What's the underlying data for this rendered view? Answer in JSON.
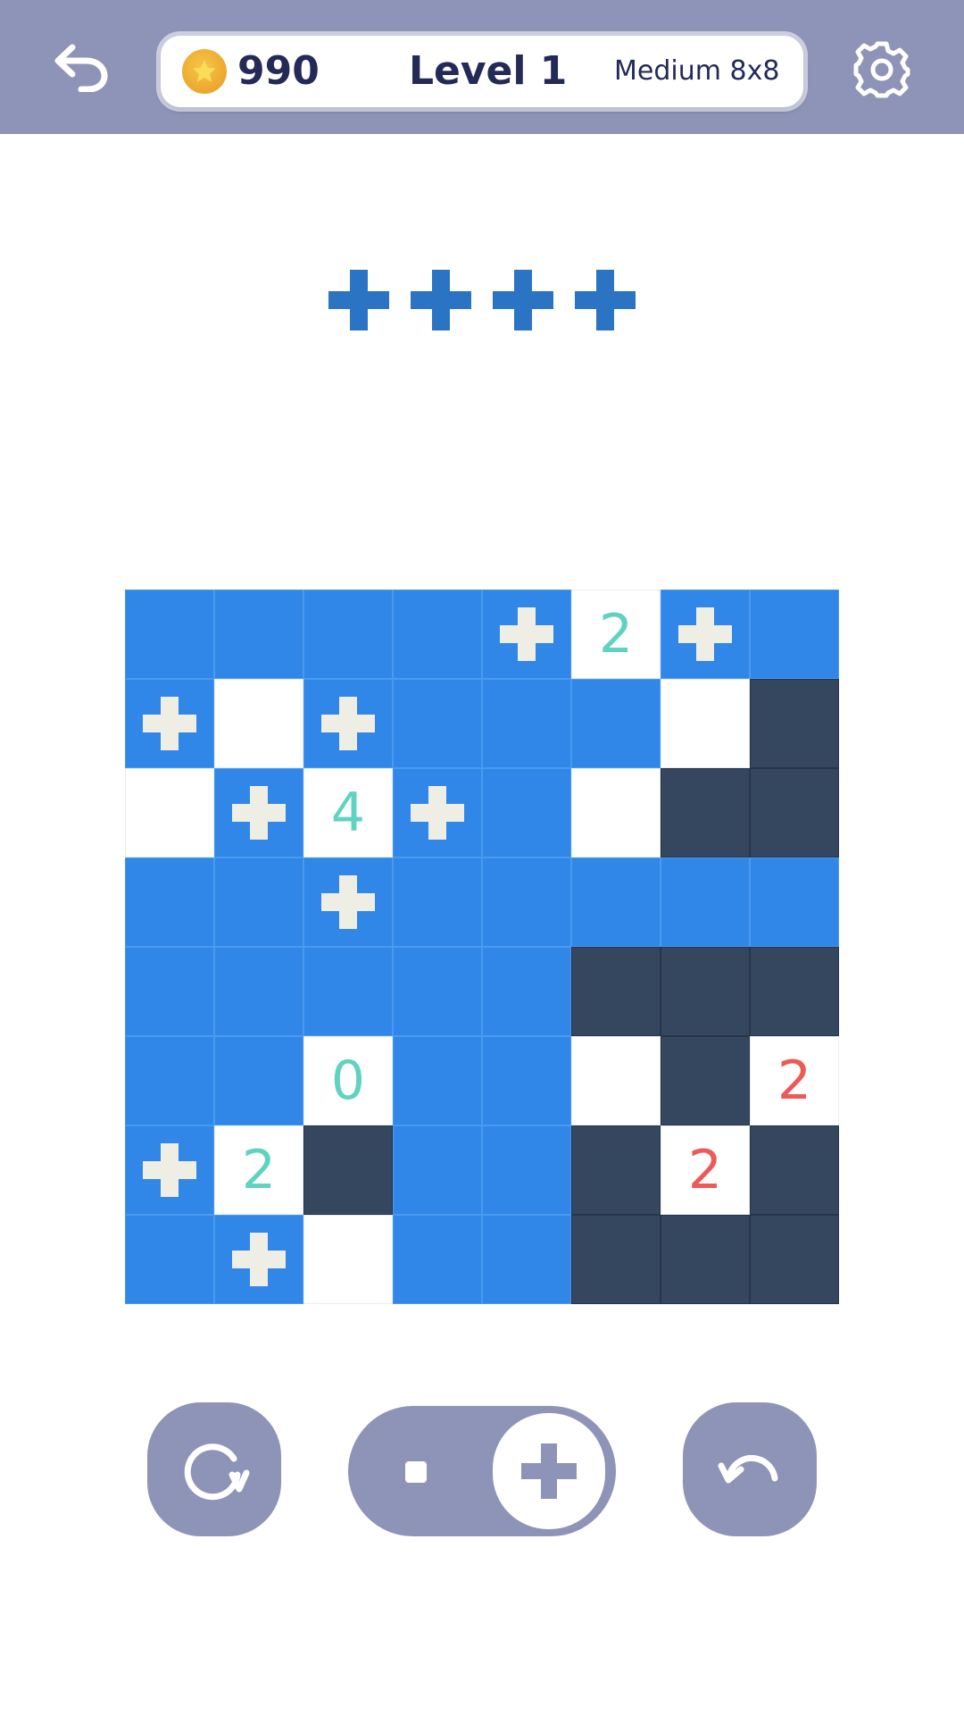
{
  "header": {
    "coins": "990",
    "level_title": "Level 1",
    "difficulty": "Medium 8x8",
    "back_icon": "back-arrow-icon",
    "settings_icon": "gear-icon",
    "coin_icon": "star-coin-icon"
  },
  "target": {
    "symbol": "plus",
    "count": 4
  },
  "board": {
    "size": 8,
    "rows": [
      [
        {
          "c": "blue"
        },
        {
          "c": "blue"
        },
        {
          "c": "blue"
        },
        {
          "c": "blue"
        },
        {
          "c": "blue",
          "mark": "plus"
        },
        {
          "c": "white",
          "num": "2",
          "tone": "teal"
        },
        {
          "c": "blue",
          "mark": "plus"
        },
        {
          "c": "blue"
        }
      ],
      [
        {
          "c": "blue",
          "mark": "plus"
        },
        {
          "c": "white"
        },
        {
          "c": "blue",
          "mark": "plus"
        },
        {
          "c": "blue"
        },
        {
          "c": "blue"
        },
        {
          "c": "blue"
        },
        {
          "c": "white"
        },
        {
          "c": "dark"
        }
      ],
      [
        {
          "c": "white"
        },
        {
          "c": "blue",
          "mark": "plus"
        },
        {
          "c": "white",
          "num": "4",
          "tone": "teal"
        },
        {
          "c": "blue",
          "mark": "plus"
        },
        {
          "c": "blue"
        },
        {
          "c": "white"
        },
        {
          "c": "dark"
        },
        {
          "c": "dark"
        }
      ],
      [
        {
          "c": "blue"
        },
        {
          "c": "blue"
        },
        {
          "c": "blue",
          "mark": "plus"
        },
        {
          "c": "blue"
        },
        {
          "c": "blue"
        },
        {
          "c": "blue"
        },
        {
          "c": "blue"
        },
        {
          "c": "blue"
        }
      ],
      [
        {
          "c": "blue"
        },
        {
          "c": "blue"
        },
        {
          "c": "blue"
        },
        {
          "c": "blue"
        },
        {
          "c": "blue"
        },
        {
          "c": "dark"
        },
        {
          "c": "dark"
        },
        {
          "c": "dark"
        }
      ],
      [
        {
          "c": "blue"
        },
        {
          "c": "blue"
        },
        {
          "c": "white",
          "num": "0",
          "tone": "teal"
        },
        {
          "c": "blue"
        },
        {
          "c": "blue"
        },
        {
          "c": "white"
        },
        {
          "c": "dark"
        },
        {
          "c": "white",
          "num": "2",
          "tone": "red"
        }
      ],
      [
        {
          "c": "blue",
          "mark": "plus"
        },
        {
          "c": "white",
          "num": "2",
          "tone": "teal"
        },
        {
          "c": "dark"
        },
        {
          "c": "blue"
        },
        {
          "c": "blue"
        },
        {
          "c": "dark"
        },
        {
          "c": "white",
          "num": "2",
          "tone": "red"
        },
        {
          "c": "dark"
        }
      ],
      [
        {
          "c": "blue"
        },
        {
          "c": "blue",
          "mark": "plus"
        },
        {
          "c": "white"
        },
        {
          "c": "blue"
        },
        {
          "c": "blue"
        },
        {
          "c": "dark"
        },
        {
          "c": "dark"
        },
        {
          "c": "dark"
        }
      ]
    ]
  },
  "controls": {
    "restart_icon": "restart-icon",
    "mode_toggle_selected": "plus",
    "undo_icon": "undo-icon"
  },
  "colors": {
    "header_bg": "#8e93b8",
    "cell_blue": "#3087e8",
    "cell_dark": "#35475f",
    "number_teal": "#5fd3bf",
    "number_red": "#ec5a58",
    "target_plus": "#2b74c4"
  }
}
